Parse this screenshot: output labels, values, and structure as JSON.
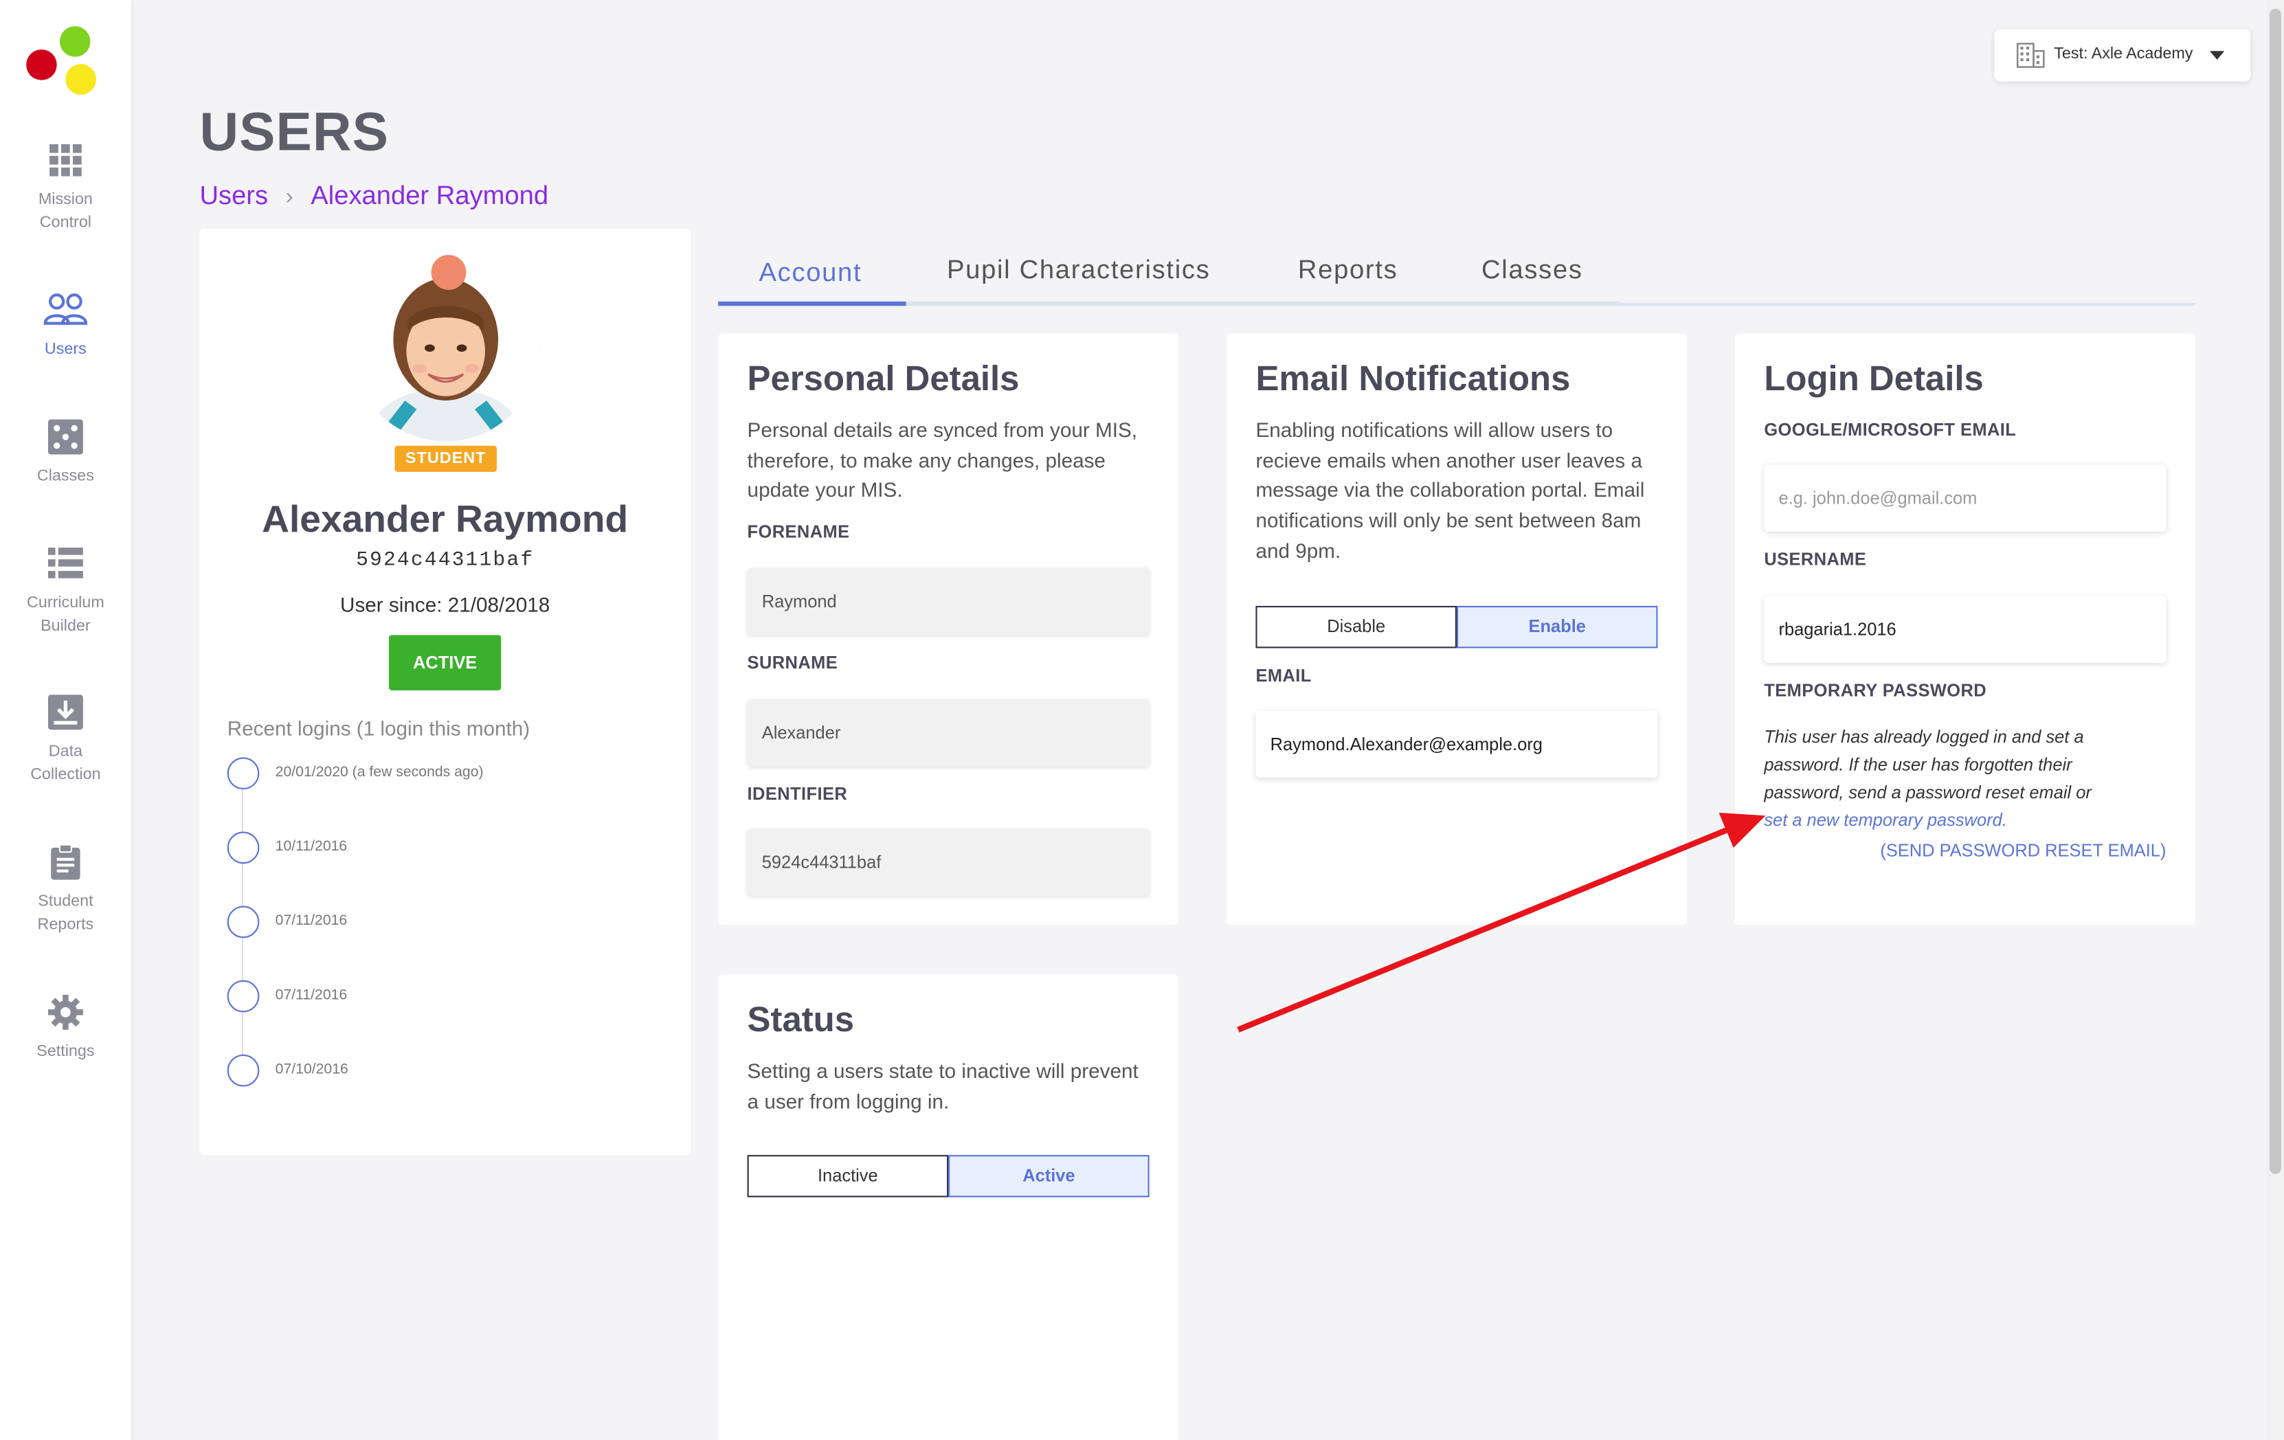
{
  "org_selector": {
    "label": "Test: Axle Academy"
  },
  "sidebar": {
    "items": [
      {
        "label_line1": "Mission",
        "label_line2": "Control"
      },
      {
        "label_line1": "Users",
        "label_line2": ""
      },
      {
        "label_line1": "Classes",
        "label_line2": ""
      },
      {
        "label_line1": "Curriculum",
        "label_line2": "Builder"
      },
      {
        "label_line1": "Data",
        "label_line2": "Collection"
      },
      {
        "label_line1": "Student",
        "label_line2": "Reports"
      },
      {
        "label_line1": "Settings",
        "label_line2": ""
      }
    ],
    "active_item": "Users"
  },
  "page": {
    "title": "USERS",
    "breadcrumb": [
      "Users",
      "Alexander Raymond"
    ],
    "breadcrumb_sep": "›"
  },
  "profile": {
    "role_badge": "STUDENT",
    "name": "Alexander Raymond",
    "identifier": "5924c44311baf",
    "user_since": "User since: 21/08/2018",
    "status_button": "ACTIVE",
    "recent_logins_title": "Recent logins (1 login this month)",
    "logins": [
      "20/01/2020 (a few seconds ago)",
      "10/11/2016",
      "07/11/2016",
      "07/11/2016",
      "07/10/2016"
    ]
  },
  "tabs": [
    "Account",
    "Pupil Characteristics",
    "Reports",
    "Classes"
  ],
  "active_tab": "Account",
  "personal_details": {
    "title": "Personal Details",
    "description_lines": [
      "Personal details are synced from your MIS,",
      "therefore, to make any changes, please",
      "update your MIS."
    ],
    "forename_label": "FORENAME",
    "forename_value": "Raymond",
    "surname_label": "SURNAME",
    "surname_value": "Alexander",
    "identifier_label": "IDENTIFIER",
    "identifier_value": "5924c44311baf"
  },
  "email_notifications": {
    "title": "Email Notifications",
    "description_lines": [
      "Enabling notifications will allow users to",
      "recieve emails when another user leaves a",
      "message via the collaboration portal. Email",
      "notifications will only be sent between 8am",
      "and 9pm."
    ],
    "toggle_off": "Disable",
    "toggle_on": "Enable",
    "selected": "Enable",
    "email_label": "EMAIL",
    "email_value": "Raymond.Alexander@example.org"
  },
  "login_details": {
    "title": "Login Details",
    "sso_label": "GOOGLE/MICROSOFT EMAIL",
    "sso_placeholder": "e.g. john.doe@gmail.com",
    "username_label": "USERNAME",
    "username_value": "rbagaria1.2016",
    "temp_password_label": "TEMPORARY PASSWORD",
    "temp_text_lines": [
      "This user has already logged in and set a",
      "password. If the user has forgotten their",
      "password, send a password reset email or"
    ],
    "temp_link": "set a new temporary password.",
    "reset_link": "(SEND PASSWORD RESET EMAIL)"
  },
  "status": {
    "title": "Status",
    "description_lines": [
      "Setting a users state to inactive will prevent",
      "a user from logging in."
    ],
    "toggle_off": "Inactive",
    "toggle_on": "Active",
    "selected": "Active"
  },
  "colors": {
    "accent": "#5b74d6",
    "breadcrumb": "#8a2be2",
    "active_green": "#3ab02d",
    "student_badge": "#f5a623",
    "annotation_arrow": "#e8141b"
  }
}
